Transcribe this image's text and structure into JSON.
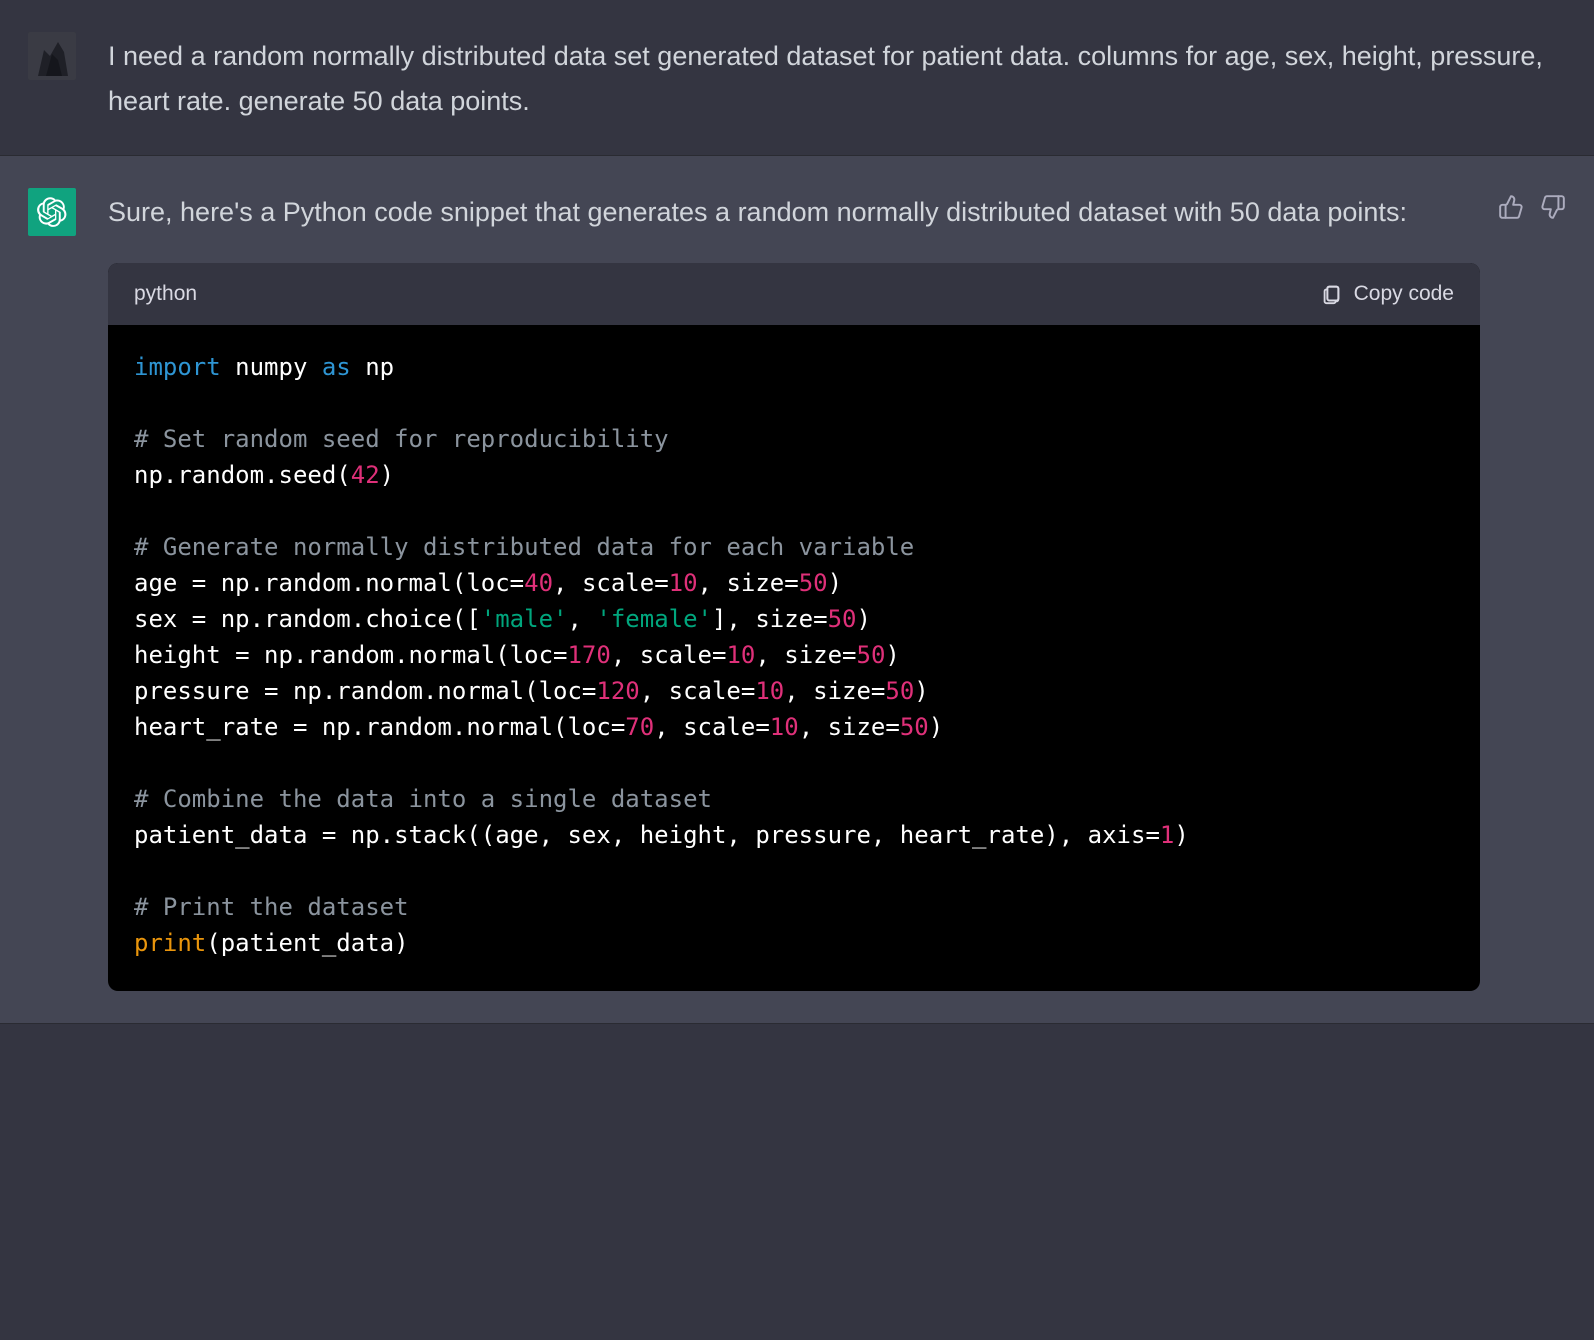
{
  "user_message": "I need a random normally distributed data set generated dataset for patient data. columns for age, sex, height, pressure, heart rate. generate 50 data points.",
  "assistant_message": "Sure, here's a Python code snippet that generates a random normally distributed dataset with 50 data points:",
  "code_block": {
    "language": "python",
    "copy_label": "Copy code",
    "tokens": [
      {
        "t": "import",
        "c": "kw"
      },
      {
        "t": " numpy ",
        "c": "mod"
      },
      {
        "t": "as",
        "c": "kw"
      },
      {
        "t": " np",
        "c": "mod"
      },
      {
        "t": "\n\n",
        "c": "mod"
      },
      {
        "t": "# Set random seed for reproducibility",
        "c": "cmt"
      },
      {
        "t": "\n",
        "c": "mod"
      },
      {
        "t": "np.random.seed(",
        "c": "mod"
      },
      {
        "t": "42",
        "c": "num"
      },
      {
        "t": ")",
        "c": "mod"
      },
      {
        "t": "\n\n",
        "c": "mod"
      },
      {
        "t": "# Generate normally distributed data for each variable",
        "c": "cmt"
      },
      {
        "t": "\n",
        "c": "mod"
      },
      {
        "t": "age = np.random.normal(loc=",
        "c": "mod"
      },
      {
        "t": "40",
        "c": "num"
      },
      {
        "t": ", scale=",
        "c": "mod"
      },
      {
        "t": "10",
        "c": "num"
      },
      {
        "t": ", size=",
        "c": "mod"
      },
      {
        "t": "50",
        "c": "num"
      },
      {
        "t": ")",
        "c": "mod"
      },
      {
        "t": "\n",
        "c": "mod"
      },
      {
        "t": "sex = np.random.choice([",
        "c": "mod"
      },
      {
        "t": "'male'",
        "c": "str"
      },
      {
        "t": ", ",
        "c": "mod"
      },
      {
        "t": "'female'",
        "c": "str"
      },
      {
        "t": "], size=",
        "c": "mod"
      },
      {
        "t": "50",
        "c": "num"
      },
      {
        "t": ")",
        "c": "mod"
      },
      {
        "t": "\n",
        "c": "mod"
      },
      {
        "t": "height = np.random.normal(loc=",
        "c": "mod"
      },
      {
        "t": "170",
        "c": "num"
      },
      {
        "t": ", scale=",
        "c": "mod"
      },
      {
        "t": "10",
        "c": "num"
      },
      {
        "t": ", size=",
        "c": "mod"
      },
      {
        "t": "50",
        "c": "num"
      },
      {
        "t": ")",
        "c": "mod"
      },
      {
        "t": "\n",
        "c": "mod"
      },
      {
        "t": "pressure = np.random.normal(loc=",
        "c": "mod"
      },
      {
        "t": "120",
        "c": "num"
      },
      {
        "t": ", scale=",
        "c": "mod"
      },
      {
        "t": "10",
        "c": "num"
      },
      {
        "t": ", size=",
        "c": "mod"
      },
      {
        "t": "50",
        "c": "num"
      },
      {
        "t": ")",
        "c": "mod"
      },
      {
        "t": "\n",
        "c": "mod"
      },
      {
        "t": "heart_rate = np.random.normal(loc=",
        "c": "mod"
      },
      {
        "t": "70",
        "c": "num"
      },
      {
        "t": ", scale=",
        "c": "mod"
      },
      {
        "t": "10",
        "c": "num"
      },
      {
        "t": ", size=",
        "c": "mod"
      },
      {
        "t": "50",
        "c": "num"
      },
      {
        "t": ")",
        "c": "mod"
      },
      {
        "t": "\n\n",
        "c": "mod"
      },
      {
        "t": "# Combine the data into a single dataset",
        "c": "cmt"
      },
      {
        "t": "\n",
        "c": "mod"
      },
      {
        "t": "patient_data = np.stack((age, sex, height, pressure, heart_rate), axis=",
        "c": "mod"
      },
      {
        "t": "1",
        "c": "num"
      },
      {
        "t": ")",
        "c": "mod"
      },
      {
        "t": "\n\n",
        "c": "mod"
      },
      {
        "t": "# Print the dataset",
        "c": "cmt"
      },
      {
        "t": "\n",
        "c": "mod"
      },
      {
        "t": "print",
        "c": "fn"
      },
      {
        "t": "(patient_data)",
        "c": "mod"
      }
    ]
  }
}
